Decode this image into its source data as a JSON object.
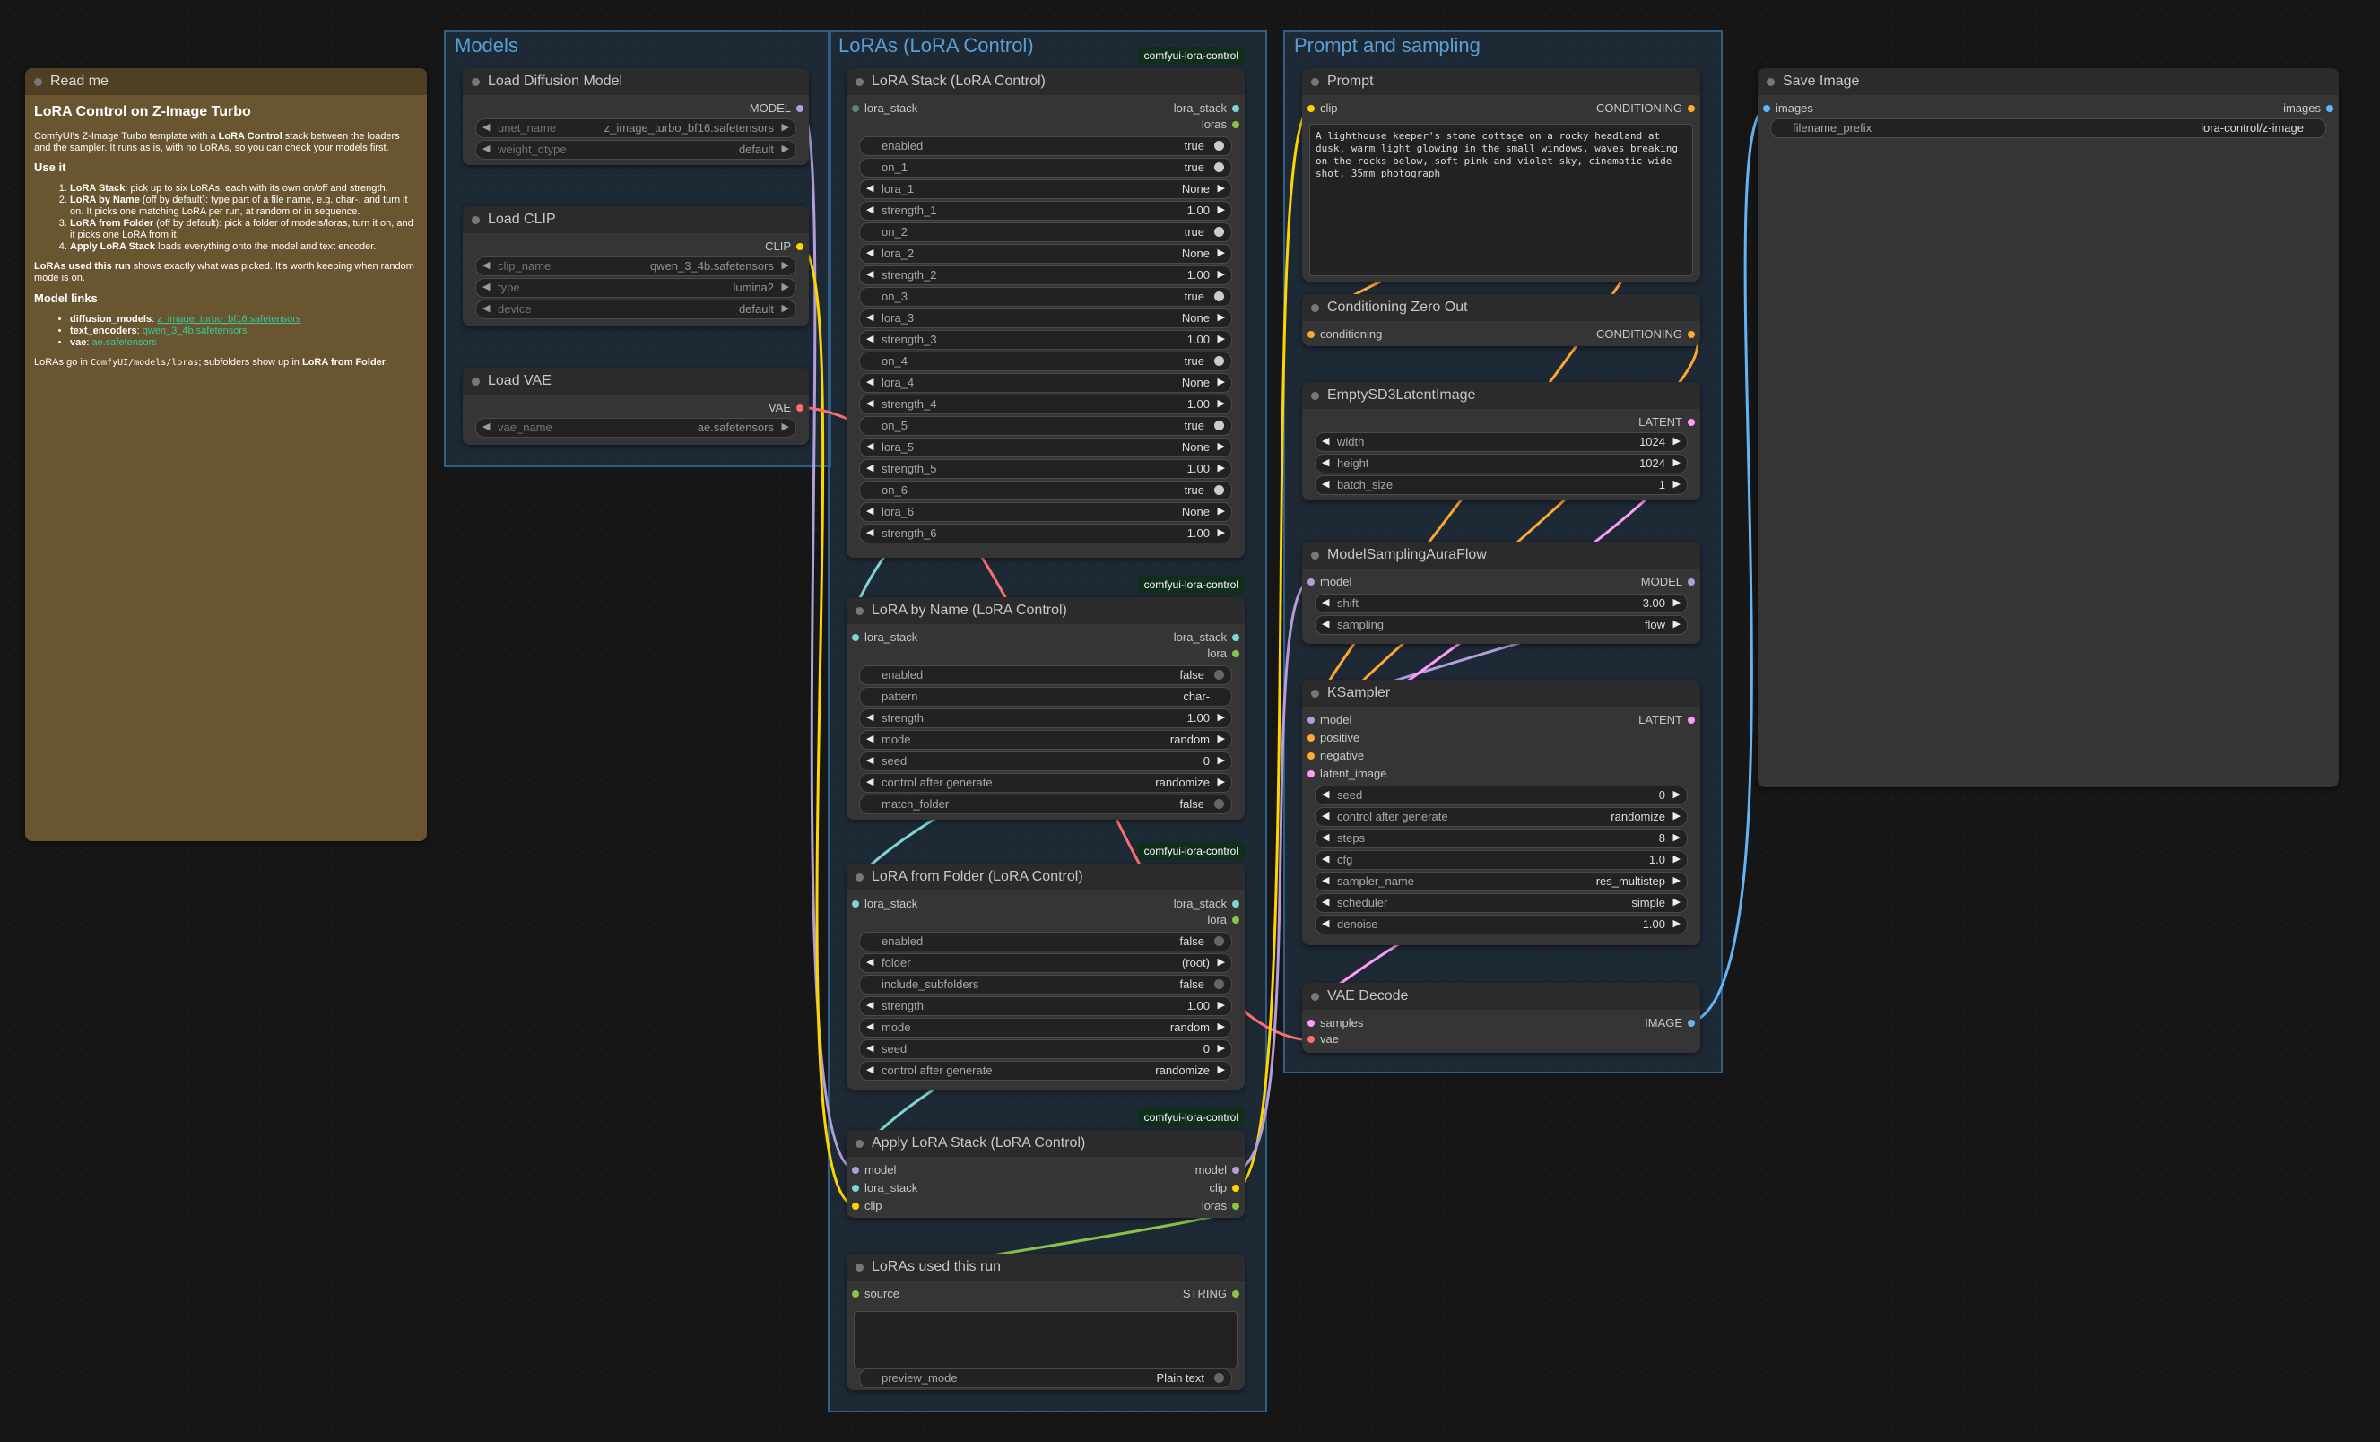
{
  "groups": {
    "models": "Models",
    "loras": "LoRAs (LoRA Control)",
    "prompt": "Prompt and sampling"
  },
  "badge": "comfyui-lora-control",
  "readme": {
    "title": "Read me",
    "heading": "LoRA Control on Z-Image Turbo",
    "intro_a": "ComfyUI's Z-Image Turbo template with a ",
    "intro_b": "LoRA Control",
    "intro_c": " stack between the loaders and the sampler. It runs as is, with no LoRAs, so you can check your models first.",
    "use_it": "Use it",
    "steps": [
      {
        "bold": "LoRA Stack",
        "text": ": pick up to six LoRAs, each with its own on/off and strength."
      },
      {
        "bold": "LoRA by Name",
        "text": " (off by default): type part of a file name, e.g. char-, and turn it on. It picks one matching LoRA per run, at random or in sequence."
      },
      {
        "bold": "LoRA from Folder",
        "text": " (off by default): pick a folder of models/loras, turn it on, and it picks one LoRA from it."
      },
      {
        "bold": "Apply LoRA Stack",
        "text": " loads everything onto the model and text encoder."
      }
    ],
    "used_bold": "LoRAs used this run",
    "used_text": " shows exactly what was picked. It's worth keeping when random mode is on.",
    "model_links": "Model links",
    "links": [
      {
        "key": "diffusion_models",
        "value": "z_image_turbo_bf16.safetensors"
      },
      {
        "key": "text_encoders",
        "value": "qwen_3_4b.safetensors"
      },
      {
        "key": "vae",
        "value": "ae.safetensors"
      }
    ],
    "footer_a": "LoRAs go in ",
    "footer_b": "ComfyUI/models/loras",
    "footer_c": "; subfolders show up in ",
    "footer_d": "LoRA from Folder",
    "footer_e": "."
  },
  "load_model": {
    "title": "Load Diffusion Model",
    "out": "MODEL",
    "w": [
      {
        "label": "unet_name",
        "value": "z_image_turbo_bf16.safetensors"
      },
      {
        "label": "weight_dtype",
        "value": "default"
      }
    ]
  },
  "load_clip": {
    "title": "Load CLIP",
    "out": "CLIP",
    "w": [
      {
        "label": "clip_name",
        "value": "qwen_3_4b.safetensors"
      },
      {
        "label": "type",
        "value": "lumina2"
      },
      {
        "label": "device",
        "value": "default"
      }
    ]
  },
  "load_vae": {
    "title": "Load VAE",
    "out": "VAE",
    "w": [
      {
        "label": "vae_name",
        "value": "ae.safetensors"
      }
    ]
  },
  "lora_stack": {
    "title": "LoRA Stack (LoRA Control)",
    "in": "lora_stack",
    "out1": "lora_stack",
    "out2": "loras",
    "w": [
      {
        "label": "enabled",
        "value": "true",
        "kind": "toggle"
      },
      {
        "label": "on_1",
        "value": "true",
        "kind": "toggle"
      },
      {
        "label": "lora_1",
        "value": "None",
        "kind": "combo"
      },
      {
        "label": "strength_1",
        "value": "1.00",
        "kind": "number"
      },
      {
        "label": "on_2",
        "value": "true",
        "kind": "toggle"
      },
      {
        "label": "lora_2",
        "value": "None",
        "kind": "combo"
      },
      {
        "label": "strength_2",
        "value": "1.00",
        "kind": "number"
      },
      {
        "label": "on_3",
        "value": "true",
        "kind": "toggle"
      },
      {
        "label": "lora_3",
        "value": "None",
        "kind": "combo"
      },
      {
        "label": "strength_3",
        "value": "1.00",
        "kind": "number"
      },
      {
        "label": "on_4",
        "value": "true",
        "kind": "toggle"
      },
      {
        "label": "lora_4",
        "value": "None",
        "kind": "combo"
      },
      {
        "label": "strength_4",
        "value": "1.00",
        "kind": "number"
      },
      {
        "label": "on_5",
        "value": "true",
        "kind": "toggle"
      },
      {
        "label": "lora_5",
        "value": "None",
        "kind": "combo"
      },
      {
        "label": "strength_5",
        "value": "1.00",
        "kind": "number"
      },
      {
        "label": "on_6",
        "value": "true",
        "kind": "toggle"
      },
      {
        "label": "lora_6",
        "value": "None",
        "kind": "combo"
      },
      {
        "label": "strength_6",
        "value": "1.00",
        "kind": "number"
      }
    ]
  },
  "lora_name": {
    "title": "LoRA by Name (LoRA Control)",
    "in": "lora_stack",
    "out1": "lora_stack",
    "out2": "lora",
    "w": [
      {
        "label": "enabled",
        "value": "false",
        "kind": "toggle"
      },
      {
        "label": "pattern",
        "value": "char-",
        "kind": "text"
      },
      {
        "label": "strength",
        "value": "1.00",
        "kind": "number"
      },
      {
        "label": "mode",
        "value": "random",
        "kind": "combo"
      },
      {
        "label": "seed",
        "value": "0",
        "kind": "number"
      },
      {
        "label": "control after generate",
        "value": "randomize",
        "kind": "combo"
      },
      {
        "label": "match_folder",
        "value": "false",
        "kind": "toggle"
      }
    ]
  },
  "lora_folder": {
    "title": "LoRA from Folder (LoRA Control)",
    "in": "lora_stack",
    "out1": "lora_stack",
    "out2": "lora",
    "w": [
      {
        "label": "enabled",
        "value": "false",
        "kind": "toggle"
      },
      {
        "label": "folder",
        "value": "(root)",
        "kind": "combo"
      },
      {
        "label": "include_subfolders",
        "value": "false",
        "kind": "toggle"
      },
      {
        "label": "strength",
        "value": "1.00",
        "kind": "number"
      },
      {
        "label": "mode",
        "value": "random",
        "kind": "combo"
      },
      {
        "label": "seed",
        "value": "0",
        "kind": "number"
      },
      {
        "label": "control after generate",
        "value": "randomize",
        "kind": "combo"
      }
    ]
  },
  "apply_stack": {
    "title": "Apply LoRA Stack (LoRA Control)",
    "in": [
      "model",
      "lora_stack",
      "clip"
    ],
    "out": [
      "model",
      "clip",
      "loras"
    ]
  },
  "loras_used": {
    "title": "LoRAs used this run",
    "in": "source",
    "out": "STRING",
    "w": [
      {
        "label": "preview_mode",
        "value": "Plain text"
      }
    ]
  },
  "prompt": {
    "title": "Prompt",
    "in": "clip",
    "out": "CONDITIONING",
    "text": "A lighthouse keeper's stone cottage on a rocky headland at dusk, warm light glowing in the small windows, waves breaking on the rocks below, soft pink and violet sky, cinematic wide shot, 35mm photograph"
  },
  "zero_out": {
    "title": "Conditioning Zero Out",
    "in": "conditioning",
    "out": "CONDITIONING"
  },
  "latent": {
    "title": "EmptySD3LatentImage",
    "out": "LATENT",
    "w": [
      {
        "label": "width",
        "value": "1024"
      },
      {
        "label": "height",
        "value": "1024"
      },
      {
        "label": "batch_size",
        "value": "1"
      }
    ]
  },
  "aura": {
    "title": "ModelSamplingAuraFlow",
    "in": "model",
    "out": "MODEL",
    "w": [
      {
        "label": "shift",
        "value": "3.00"
      },
      {
        "label": "sampling",
        "value": "flow"
      }
    ]
  },
  "ksampler": {
    "title": "KSampler",
    "in": [
      "model",
      "positive",
      "negative",
      "latent_image"
    ],
    "out": "LATENT",
    "w": [
      {
        "label": "seed",
        "value": "0"
      },
      {
        "label": "control after generate",
        "value": "randomize"
      },
      {
        "label": "steps",
        "value": "8"
      },
      {
        "label": "cfg",
        "value": "1.0"
      },
      {
        "label": "sampler_name",
        "value": "res_multistep"
      },
      {
        "label": "scheduler",
        "value": "simple"
      },
      {
        "label": "denoise",
        "value": "1.00"
      }
    ]
  },
  "vae_decode": {
    "title": "VAE Decode",
    "in": [
      "samples",
      "vae"
    ],
    "out": "IMAGE"
  },
  "save": {
    "title": "Save Image",
    "in": "images",
    "out": "images",
    "w": [
      {
        "label": "filename_prefix",
        "value": "lora-control/z-image"
      }
    ]
  },
  "colors": {
    "model": "#b39ddb",
    "clip": "#ffd500",
    "vae": "#ff6e6e",
    "conditioning": "#ffa931",
    "latent": "#ff9cf9",
    "image": "#64b5f6",
    "lora_stack": "#7fd6cf",
    "string": "#8bc34a"
  }
}
